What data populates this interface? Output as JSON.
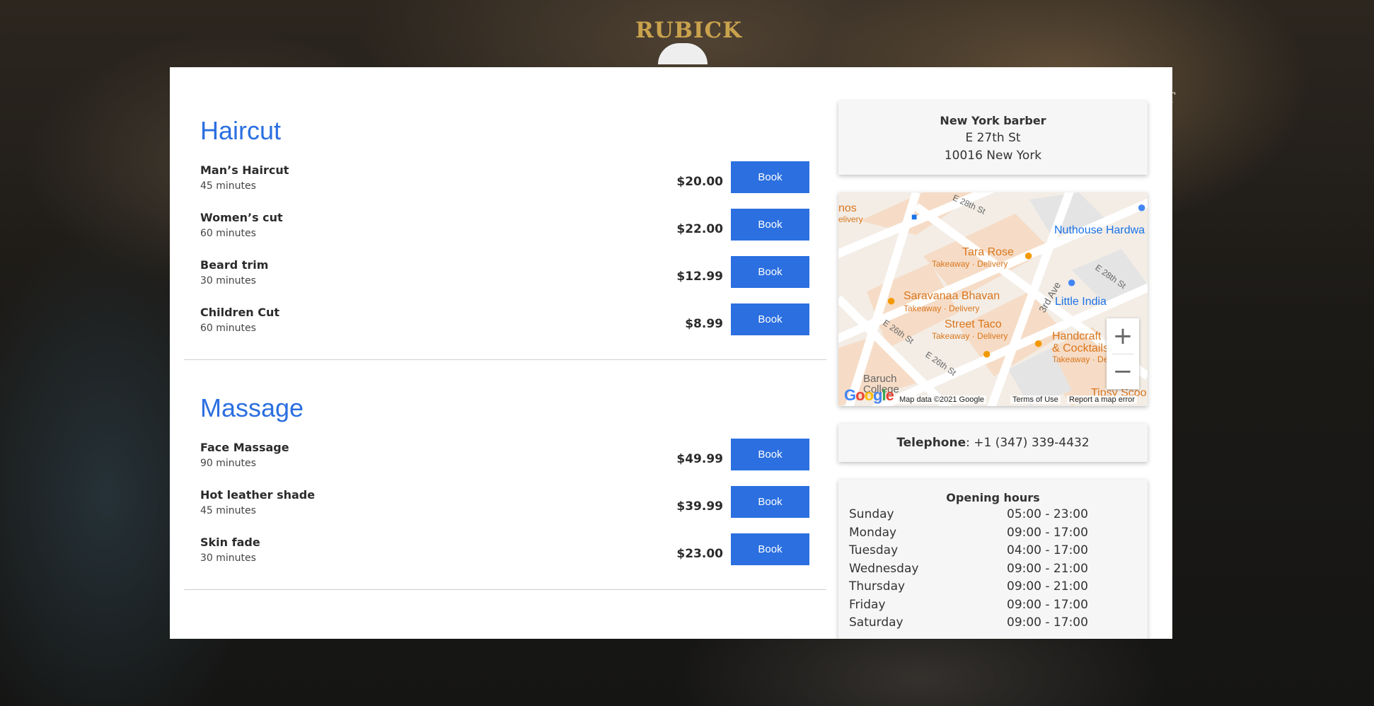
{
  "brand": {
    "name": "RUBICK"
  },
  "nav": {
    "fragment": "T"
  },
  "sections": [
    {
      "title": "Haircut",
      "services": [
        {
          "name": "Man’s Haircut",
          "duration": "45 minutes",
          "price": "$20.00",
          "button": "Book"
        },
        {
          "name": "Women’s cut",
          "duration": "60 minutes",
          "price": "$22.00",
          "button": "Book"
        },
        {
          "name": "Beard trim",
          "duration": "30 minutes",
          "price": "$12.99",
          "button": "Book"
        },
        {
          "name": "Children Cut",
          "duration": "60 minutes",
          "price": "$8.99",
          "button": "Book"
        }
      ]
    },
    {
      "title": "Massage",
      "services": [
        {
          "name": "Face Massage",
          "duration": "90 minutes",
          "price": "$49.99",
          "button": "Book"
        },
        {
          "name": "Hot leather shade",
          "duration": "45 minutes",
          "price": "$39.99",
          "button": "Book"
        },
        {
          "name": "Skin fade",
          "duration": "30 minutes",
          "price": "$23.00",
          "button": "Book"
        }
      ]
    }
  ],
  "location": {
    "name": "New York barber",
    "street": "E 27th St",
    "city": "10016 New York"
  },
  "map": {
    "labels": {
      "street_e28": "E 28th St",
      "street_e28_right": "E 28th St",
      "street_3rd_ave": "3rd Ave",
      "street_e26": "E 26th St",
      "street_e26_mid": "E 26th St",
      "nuthouse": "Nuthouse Hardwa",
      "tara_rose": "Tara Rose",
      "tara_rose_sub": "Takeaway · Delivery",
      "saravanaa": "Saravanaa Bhavan",
      "saravanaa_sub": "Takeaway · Delivery",
      "street_taco": "Street Taco",
      "street_taco_sub": "Takeaway · Delivery",
      "little_india": "Little India",
      "handcraft": "Handcraft",
      "handcraft_2": "& Cocktails",
      "handcraft_sub": "Takeaway · De",
      "baruch": "Baruch",
      "college": "College",
      "tipsy": "Tipsy Scoo",
      "edge_left": "nos",
      "edge_left_sub": "elivery"
    },
    "zoom_in": "+",
    "zoom_out": "−",
    "google": [
      "G",
      "o",
      "o",
      "g",
      "l",
      "e"
    ],
    "attribution": "Map data ©2021 Google",
    "terms": "Terms of Use",
    "report": "Report a map error"
  },
  "phone": {
    "label": "Telephone",
    "number": ": +1 (347) 339-4432"
  },
  "hours": {
    "title": "Opening hours",
    "rows": [
      {
        "day": "Sunday",
        "time": "05:00 - 23:00"
      },
      {
        "day": "Monday",
        "time": "09:00 - 17:00"
      },
      {
        "day": "Tuesday",
        "time": "04:00 - 17:00"
      },
      {
        "day": "Wednesday",
        "time": "09:00 - 21:00"
      },
      {
        "day": "Thursday",
        "time": "09:00 - 21:00"
      },
      {
        "day": "Friday",
        "time": "09:00 - 17:00"
      },
      {
        "day": "Saturday",
        "time": "09:00 - 17:00"
      }
    ]
  },
  "colors": {
    "accent": "#2b6fe0",
    "brand_gold": "#c9a24d"
  }
}
